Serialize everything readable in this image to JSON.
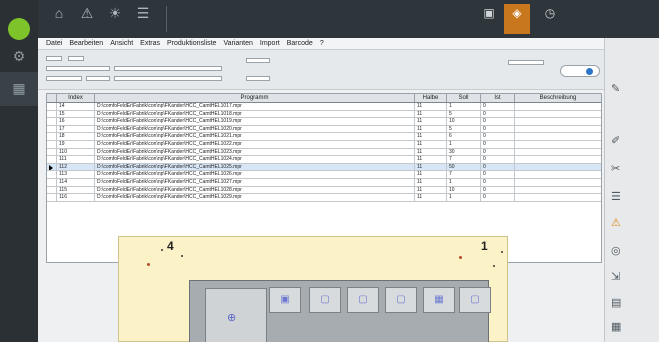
{
  "menubar": [
    "Datei",
    "Bearbeiten",
    "Ansicht",
    "Extras",
    "Produktionsliste",
    "Varianten",
    "Import",
    "Barcode",
    "?"
  ],
  "table": {
    "headers": {
      "index": "Index",
      "program": "Programm",
      "halbe": "Halbe",
      "soll": "Soll",
      "ist": "Ist",
      "desc": "Beschreibung"
    },
    "rows": [
      {
        "index": "14",
        "program": "D:\\comfoFeldEr\\Fabrik\\con\\np\\FKander\\HCC_CamtHEL1017.mpr",
        "halbe": "11",
        "soll": "1",
        "ist": "0",
        "selected": false
      },
      {
        "index": "15",
        "program": "D:\\comfoFeldEr\\Fabrik\\con\\np\\FKander\\HCC_CamtHEL1018.mpr",
        "halbe": "11",
        "soll": "5",
        "ist": "0",
        "selected": false
      },
      {
        "index": "16",
        "program": "D:\\comfoFeldEr\\Fabrik\\con\\np\\FKander\\HCC_CamtHEL1019.mpr",
        "halbe": "11",
        "soll": "10",
        "ist": "0",
        "selected": false
      },
      {
        "index": "17",
        "program": "D:\\comfoFeldEr\\Fabrik\\con\\np\\FKander\\HCC_CamtHEL1020.mpr",
        "halbe": "11",
        "soll": "5",
        "ist": "0",
        "selected": false
      },
      {
        "index": "18",
        "program": "D:\\comfoFeldEr\\Fabrik\\con\\np\\FKander\\HCC_CamtHEL1021.mpr",
        "halbe": "11",
        "soll": "6",
        "ist": "0",
        "selected": false
      },
      {
        "index": "19",
        "program": "D:\\comfoFeldEr\\Fabrik\\con\\np\\FKander\\HCC_CamtHEL1022.mpr",
        "halbe": "11",
        "soll": "1",
        "ist": "0",
        "selected": false
      },
      {
        "index": "110",
        "program": "D:\\comfoFeldEr\\Fabrik\\con\\np\\FKander\\HCC_CamtHEL1023.mpr",
        "halbe": "11",
        "soll": "30",
        "ist": "0",
        "selected": false
      },
      {
        "index": "111",
        "program": "D:\\comfoFeldEr\\Fabrik\\con\\np\\FKander\\HCC_CamtHEL1024.mpr",
        "halbe": "11",
        "soll": "7",
        "ist": "0",
        "selected": false
      },
      {
        "index": "112",
        "program": "D:\\comfoFeldEr\\Fabrik\\con\\np\\FKander\\HCC_CamtHEL1025.mpr",
        "halbe": "11",
        "soll": "50",
        "ist": "0",
        "selected": true
      },
      {
        "index": "113",
        "program": "D:\\comfoFeldEr\\Fabrik\\con\\np\\FKander\\HCC_CamtHEL1026.mpr",
        "halbe": "11",
        "soll": "7",
        "ist": "0",
        "selected": false
      },
      {
        "index": "114",
        "program": "D:\\comfoFeldEr\\Fabrik\\con\\np\\FKander\\HCC_CamtHEL1027.mpr",
        "halbe": "11",
        "soll": "1",
        "ist": "0",
        "selected": false
      },
      {
        "index": "115",
        "program": "D:\\comfoFeldEr\\Fabrik\\con\\np\\FKander\\HCC_CamtHEL1028.mpr",
        "halbe": "11",
        "soll": "10",
        "ist": "0",
        "selected": false
      },
      {
        "index": "116",
        "program": "D:\\comfoFeldEr\\Fabrik\\con\\np\\FKander\\HCC_CamtHEL1029.mpr",
        "halbe": "11",
        "soll": "1",
        "ist": "0",
        "selected": false
      }
    ]
  },
  "preview": {
    "label_left": "4",
    "label_right": "1"
  },
  "colors": {
    "accent_green": "#7ec32a",
    "accent_orange": "#c8771c",
    "selection": "#d6e6f7",
    "preview_bg": "#fbf2c8"
  }
}
